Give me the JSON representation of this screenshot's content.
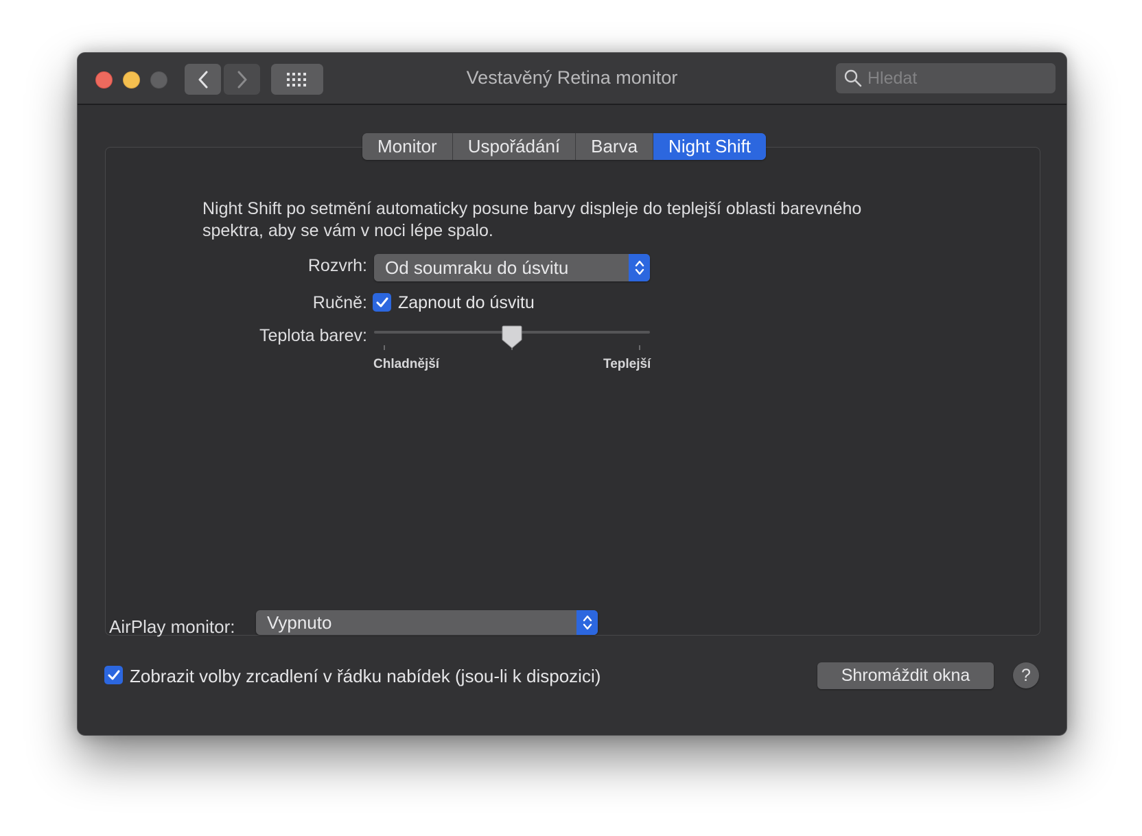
{
  "window": {
    "title": "Vestavěný Retina monitor",
    "search_placeholder": "Hledat"
  },
  "tabs": [
    {
      "label": "Monitor",
      "active": false
    },
    {
      "label": "Uspořádání",
      "active": false
    },
    {
      "label": "Barva",
      "active": false
    },
    {
      "label": "Night Shift",
      "active": true
    }
  ],
  "night_shift": {
    "description": "Night Shift po setmění automaticky posune barvy displeje do teplejší oblasti barevného spektra, aby se vám v noci lépe spalo.",
    "schedule_label": "Rozvrh:",
    "schedule_value": "Od soumraku do úsvitu",
    "manual_label": "Ručně:",
    "manual_checkbox_label": "Zapnout do úsvitu",
    "manual_checked": true,
    "temperature_label": "Teplota barev:",
    "temperature_min_label": "Chladnější",
    "temperature_max_label": "Teplejší",
    "temperature_value": 0.5
  },
  "airplay": {
    "label": "AirPlay monitor:",
    "value": "Vypnuto"
  },
  "mirroring": {
    "checkbox_label": "Zobrazit volby zrcadlení v řádku nabídek (jsou-li k dispozici)",
    "checked": true
  },
  "buttons": {
    "gather_windows": "Shromáždit okna",
    "help": "?"
  },
  "colors": {
    "accent": "#2c67df",
    "window_bg": "#323234",
    "close": "#ed6a5e",
    "minimize": "#f4bf4f"
  }
}
